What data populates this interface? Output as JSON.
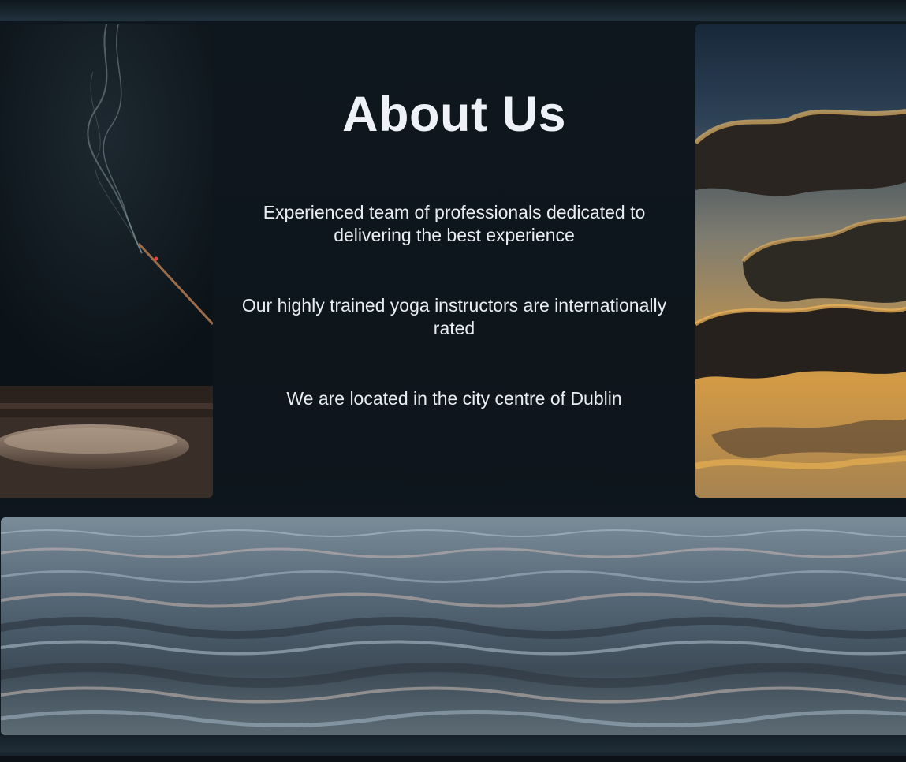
{
  "about": {
    "title": "About Us",
    "paragraphs": [
      "Experienced team of professionals dedicated to delivering the best experience",
      "Our highly trained yoga instructors are internationally rated",
      "We are located in the city centre of Dublin"
    ]
  },
  "images": {
    "left": "incense-stick-photo",
    "right": "sunset-clouds-photo",
    "bottom": "ocean-waves-photo"
  },
  "colors": {
    "background": "#0e151c",
    "text": "#e9edf2",
    "title": "#eef1f8"
  }
}
